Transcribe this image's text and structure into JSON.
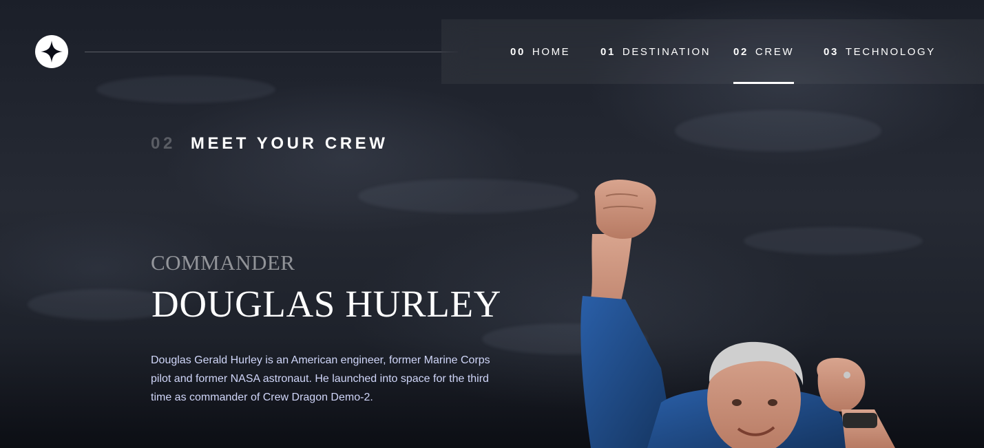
{
  "nav": {
    "items": [
      {
        "num": "00",
        "label": "HOME"
      },
      {
        "num": "01",
        "label": "DESTINATION"
      },
      {
        "num": "02",
        "label": "CREW"
      },
      {
        "num": "03",
        "label": "TECHNOLOGY"
      }
    ],
    "active_index": 2
  },
  "section": {
    "num": "02",
    "title": "MEET YOUR CREW"
  },
  "crew": {
    "role": "COMMANDER",
    "name": "DOUGLAS HURLEY",
    "bio": "Douglas Gerald Hurley is an American engineer, former Marine Corps pilot and former NASA astronaut. He launched into space for the third time as commander of Crew Dragon Demo-2."
  },
  "colors": {
    "accent": "#ffffff",
    "bio_text": "#d0d6f9",
    "background": "#1b1f29"
  },
  "icons": {
    "logo": "star-logo-icon"
  }
}
